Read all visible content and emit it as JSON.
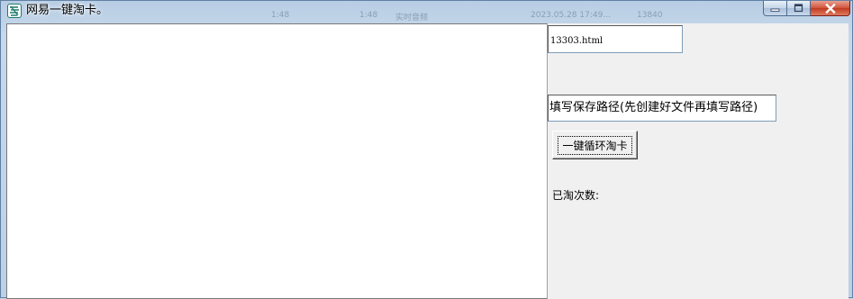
{
  "window": {
    "title": "网易一键淘卡。",
    "ghost_titles": [
      "1:48",
      "1:48",
      "实时音频",
      "2023.05.28 17:49...",
      "13840"
    ]
  },
  "caption_buttons": {
    "minimize_icon": "minimize-icon",
    "maximize_icon": "maximize-icon",
    "close_icon": "close-icon"
  },
  "form": {
    "filename_value": "13303.html",
    "path_value": "填写保存路径(先创建好文件再填写路径)",
    "loop_button_label": "一键循环淘卡",
    "count_label": "已淘次数:"
  },
  "colors": {
    "close_button": "#c03a22",
    "app_icon": "#1e7b6a"
  }
}
